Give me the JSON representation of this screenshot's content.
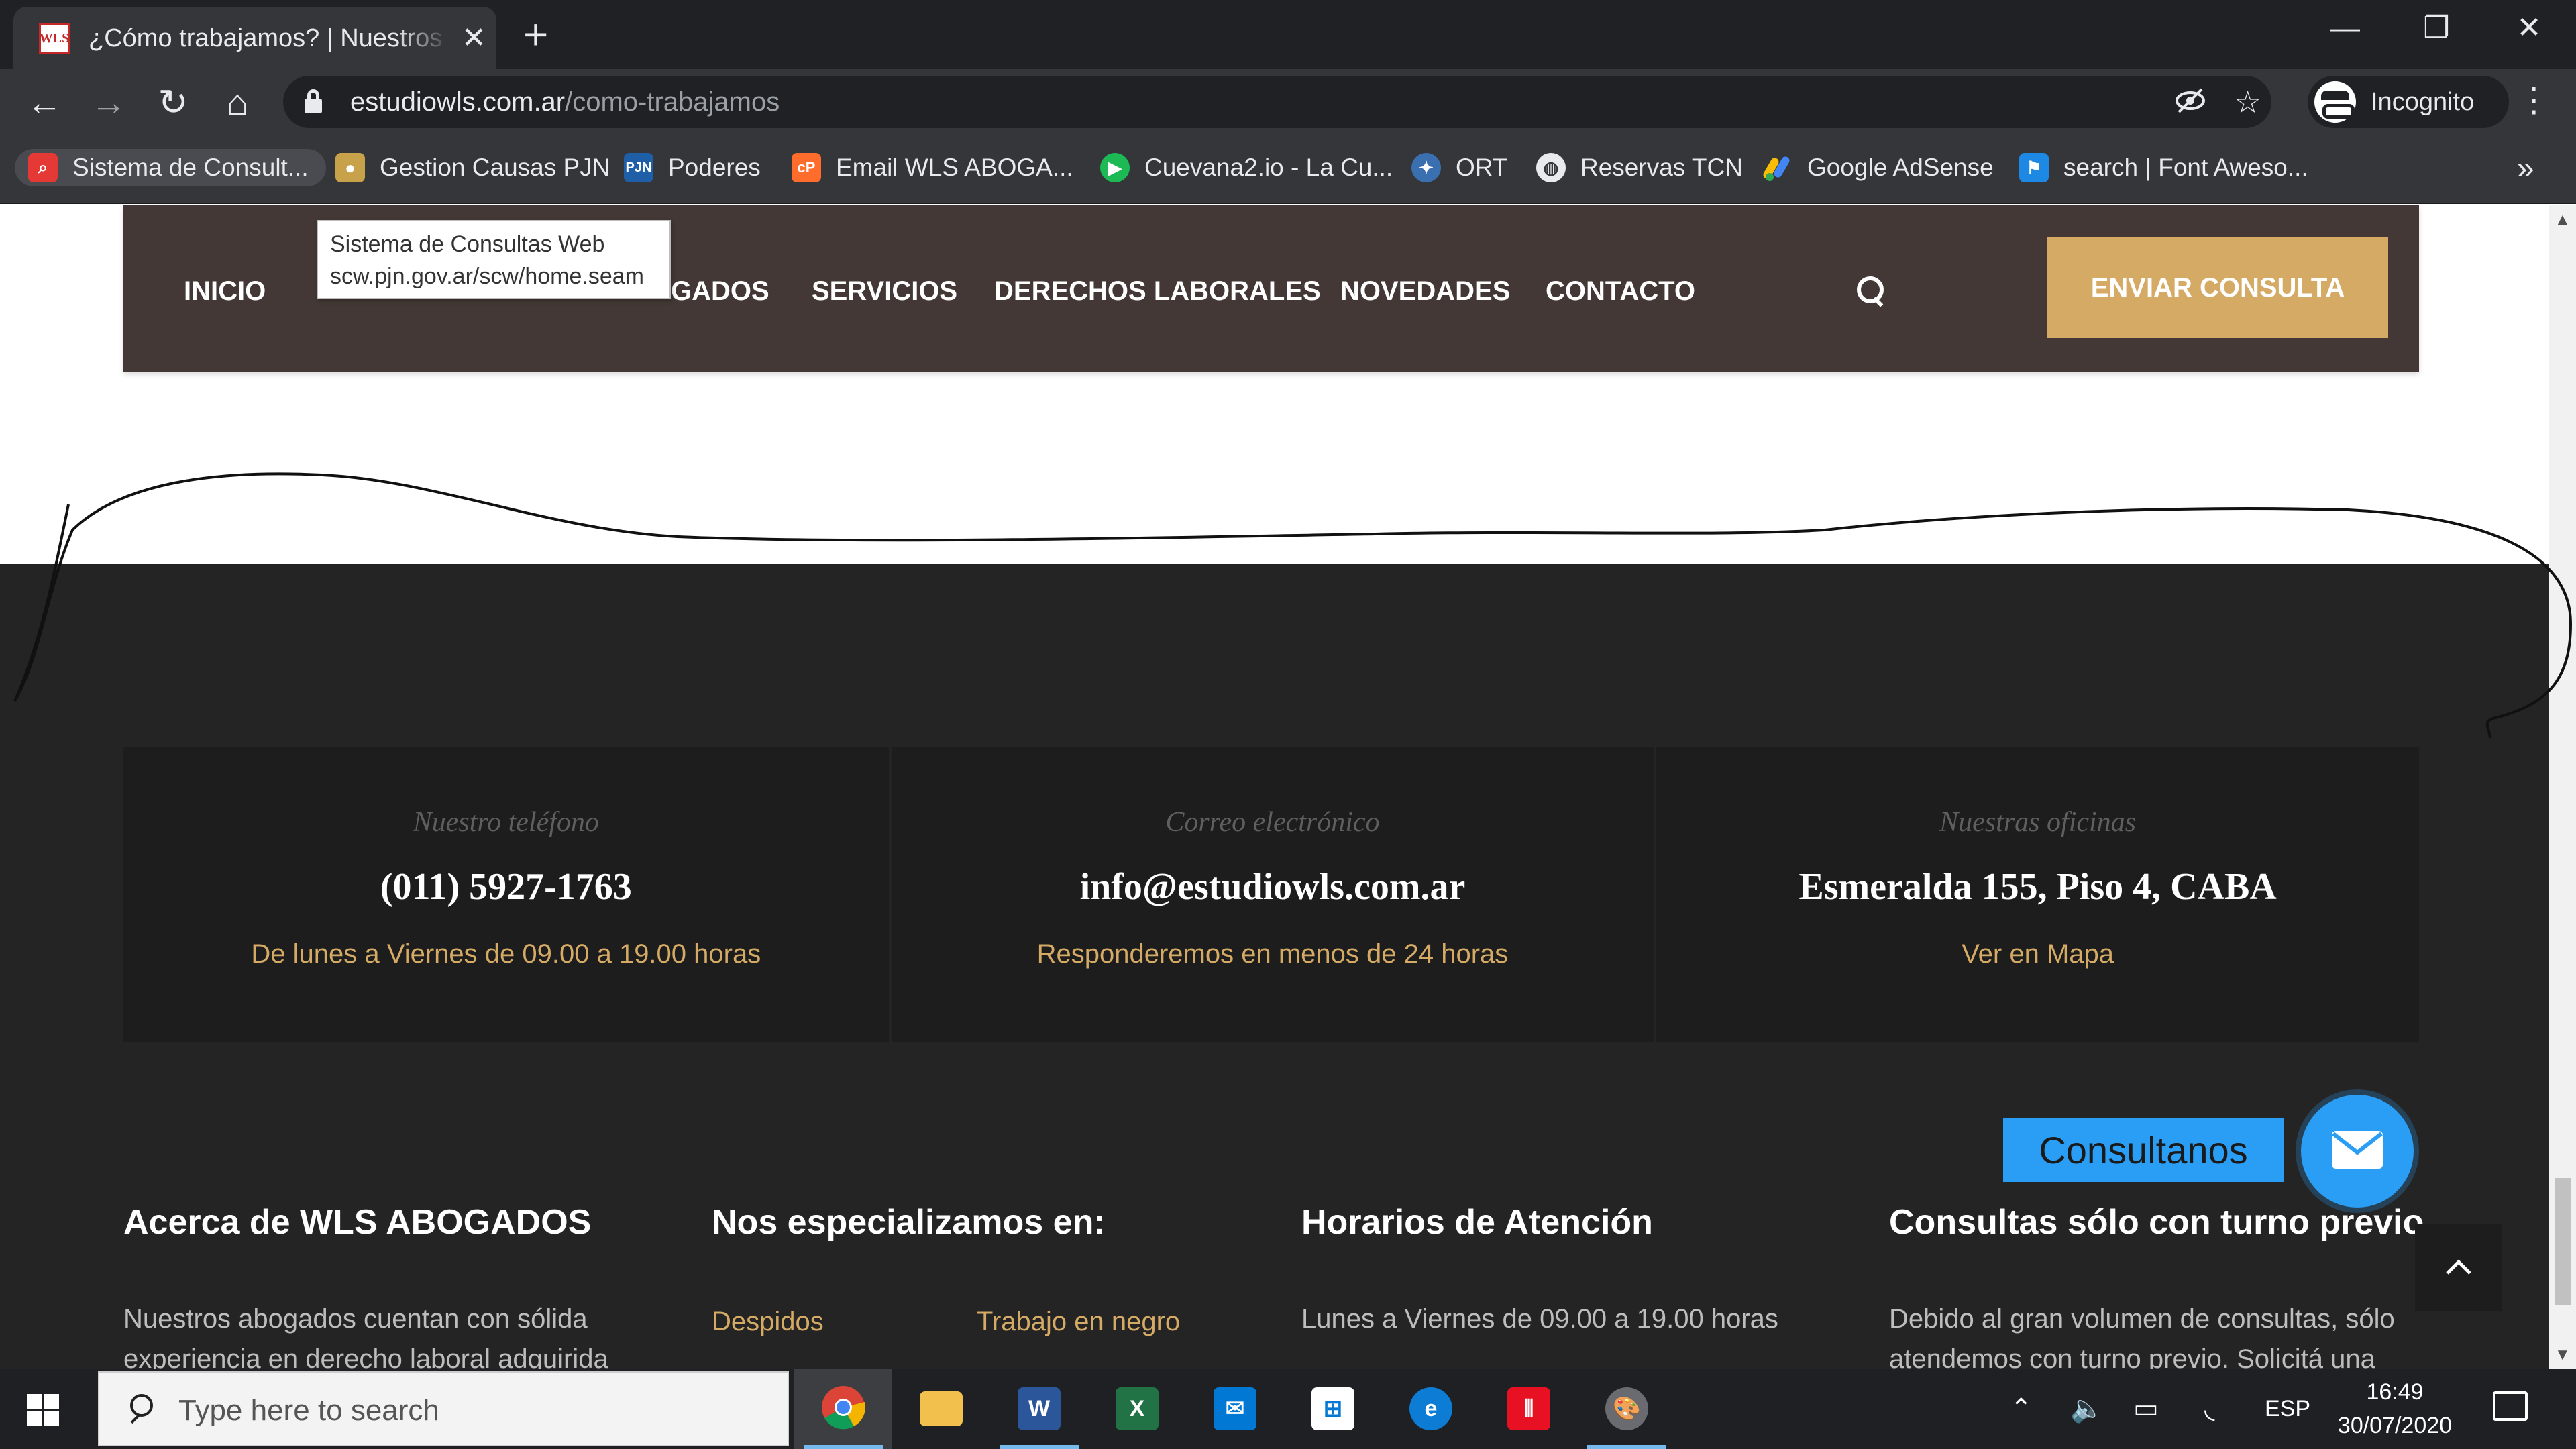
{
  "browser": {
    "tab_title": "¿Cómo trabajamos? | Nuestros Clientes",
    "tab_favicon_text": "WLS",
    "url_domain": "estudiowls.com.ar",
    "url_path": "/como-trabajamos",
    "profile_label": "Incognito",
    "bookmarks": [
      {
        "label": "Sistema de Consult...",
        "icon_color": "#e53935"
      },
      {
        "label": "Gestion Causas PJN",
        "icon_color": "#c8a24a"
      },
      {
        "label": "Poderes",
        "icon_color": "#1f5fa8"
      },
      {
        "label": "Email WLS ABOGA...",
        "icon_color": "#ff6c2c"
      },
      {
        "label": "Cuevana2.io - La Cu...",
        "icon_color": "#1db954"
      },
      {
        "label": "ORT",
        "icon_color": "#3a6fb0"
      },
      {
        "label": "Reservas TCN",
        "icon_color": "#ffffff"
      },
      {
        "label": "Google AdSense",
        "icon_color": "#fbbc04"
      },
      {
        "label": "search | Font Aweso...",
        "icon_color": "#1e88e5"
      }
    ]
  },
  "tooltip": {
    "title": "Sistema de Consultas Web",
    "url": "scw.pjn.gov.ar/scw/home.seam"
  },
  "nav": {
    "items": [
      "INICIO",
      "ABOGADOS",
      "SERVICIOS",
      "DERECHOS LABORALES",
      "NOVEDADES",
      "CONTACTO"
    ],
    "abogados_visible": "GADOS",
    "cta": "ENVIAR CONSULTA"
  },
  "contact": [
    {
      "label": "Nuestro teléfono",
      "value": "(011) 5927-1763",
      "sub": "De lunes a Viernes de 09.00 a 19.00 horas"
    },
    {
      "label": "Correo electrónico",
      "value": "info@estudiowls.com.ar",
      "sub": "Responderemos en menos de 24 horas"
    },
    {
      "label": "Nuestras oficinas",
      "value": "Esmeralda 155, Piso 4, CABA",
      "sub": "Ver en Mapa"
    }
  ],
  "footer": {
    "about_title": "Acerca de WLS ABOGADOS",
    "about_text": "Nuestros abogados cuentan con sólida experiencia en derecho laboral adquirida",
    "spec_title": "Nos especializamos en:",
    "spec_links": [
      "Despidos",
      "Trabajo en negro"
    ],
    "hours_title": "Horarios de Atención",
    "hours_text": "Lunes a Viernes de 09.00 a 19.00 horas",
    "turno_title": "Consultas sólo con turno previo",
    "turno_text": "Debido al gran volumen de consultas, sólo atendemos con turno previo. Solicitá una"
  },
  "consult_widget": {
    "label": "Consultanos"
  },
  "taskbar": {
    "search_placeholder": "Type here to search",
    "language": "ESP",
    "time": "16:49",
    "date": "30/07/2020"
  },
  "colors": {
    "nav_bg": "#433835",
    "accent_gold": "#d4aa65",
    "footer_bg": "#242424",
    "contact_box_bg": "#1d1d1d",
    "consult_blue": "#2a9df4"
  }
}
